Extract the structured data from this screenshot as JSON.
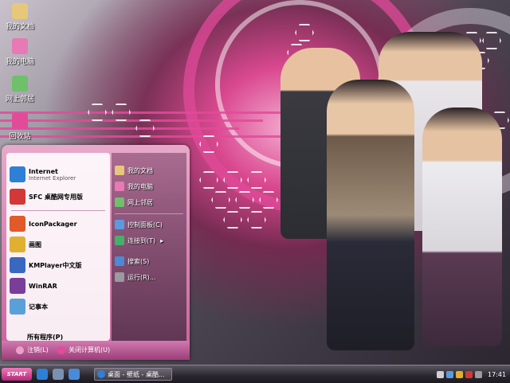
{
  "desktop_icons": [
    {
      "label": "我的文档",
      "icon": "documents-folder-icon",
      "color": "#e7c77a"
    },
    {
      "label": "我的电脑",
      "icon": "computer-icon",
      "color": "#e779b4"
    },
    {
      "label": "网上邻居",
      "icon": "network-icon",
      "color": "#6fc06a"
    },
    {
      "label": "回收站",
      "icon": "recycle-bin-icon",
      "color": "#e24a9a"
    }
  ],
  "start_menu": {
    "pinned": [
      {
        "title": "Internet",
        "subtitle": "Internet Explorer",
        "icon": "internet-explorer-icon",
        "color": "#2e7fd6"
      },
      {
        "title": "SFC 桌酷网专用版",
        "subtitle": "",
        "icon": "sfc-icon",
        "color": "#d23838"
      }
    ],
    "programs": [
      {
        "title": "IconPackager",
        "icon": "iconpackager-icon",
        "color": "#e05a2a"
      },
      {
        "title": "画图",
        "icon": "paint-icon",
        "color": "#e0b030"
      },
      {
        "title": "KMPlayer中文版",
        "icon": "kmplayer-icon",
        "color": "#3a68c0"
      },
      {
        "title": "WinRAR",
        "icon": "winrar-icon",
        "color": "#7a3d9a"
      },
      {
        "title": "记事本",
        "icon": "notepad-icon",
        "color": "#5aa0d8"
      }
    ],
    "all_programs": "所有程序(P)",
    "right_items": [
      {
        "label": "我的文档",
        "icon": "documents-icon",
        "color": "#e7c77a"
      },
      {
        "label": "我的电脑",
        "icon": "computer-icon",
        "color": "#e779b4"
      },
      {
        "label": "网上邻居",
        "icon": "network-icon",
        "color": "#6fc06a"
      },
      {
        "label": "控制面板(C)",
        "icon": "control-panel-icon",
        "color": "#5a9be0"
      },
      {
        "label": "连接到(T)",
        "icon": "connect-icon",
        "color": "#45b06a"
      },
      {
        "label": "搜索(S)",
        "icon": "search-icon",
        "color": "#4a8ad8"
      },
      {
        "label": "运行(R)...",
        "icon": "run-icon",
        "color": "#9a9aa0"
      }
    ],
    "logoff": "注销(L)",
    "shutdown": "关闭计算机(U)"
  },
  "taskbar": {
    "start_label": "START",
    "task_item": "桌面 - 壁纸 - 桌酷...",
    "clock": "17:41"
  },
  "colors": {
    "accent": "#e24a9a",
    "taskbar": "#2a262e"
  }
}
